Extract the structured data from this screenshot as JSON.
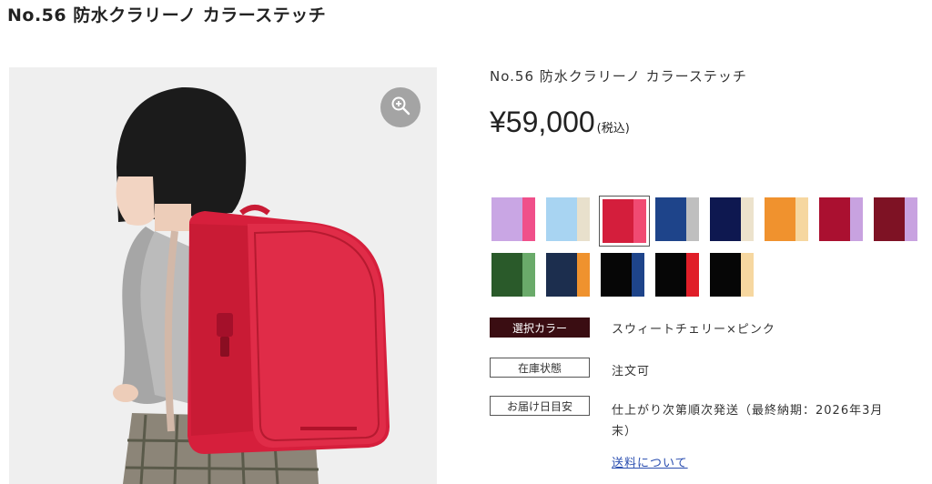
{
  "page": {
    "title": "No.56 防水クラリーノ カラーステッチ"
  },
  "product": {
    "name": "No.56 防水クラリーノ カラーステッチ",
    "price": "¥59,000",
    "tax_note": "(税込)"
  },
  "gallery": {
    "zoom_icon": "zoom-in-icon"
  },
  "swatches": [
    {
      "main": "#c9a6e4",
      "accent": "#f0508a"
    },
    {
      "main": "#a8d4f2",
      "accent": "#e8e0cc"
    },
    {
      "main": "#d41e3c",
      "accent": "#f04a72",
      "selected": true
    },
    {
      "main": "#1e448a",
      "accent": "#bfbfbf"
    },
    {
      "main": "#0e1850",
      "accent": "#ece2cc"
    },
    {
      "main": "#f0922e",
      "accent": "#f6d7a0"
    },
    {
      "main": "#aa1030",
      "accent": "#c8a2e0"
    },
    {
      "main": "#7e1224",
      "accent": "#c8a2e0"
    },
    {
      "main": "#2a5a2a",
      "accent": "#6aaa6a"
    },
    {
      "main": "#1c2e4e",
      "accent": "#ef922e"
    },
    {
      "main": "#060606",
      "accent": "#1e448a"
    },
    {
      "main": "#060606",
      "accent": "#e01e28"
    },
    {
      "main": "#060606",
      "accent": "#f6d7a0"
    }
  ],
  "info": {
    "color_label": "選択カラー",
    "color_value": "スウィートチェリー×ピンク",
    "stock_label": "在庫状態",
    "stock_value": "注文可",
    "delivery_label": "お届け日目安",
    "delivery_value_line1": "仕上がり次第順次発送（最終納期：2026年3月",
    "delivery_value_line2": "末）",
    "shipping_link": "送料について"
  },
  "colors": {
    "accent_dark": "#3a0d12",
    "link": "#2a4eb0"
  }
}
